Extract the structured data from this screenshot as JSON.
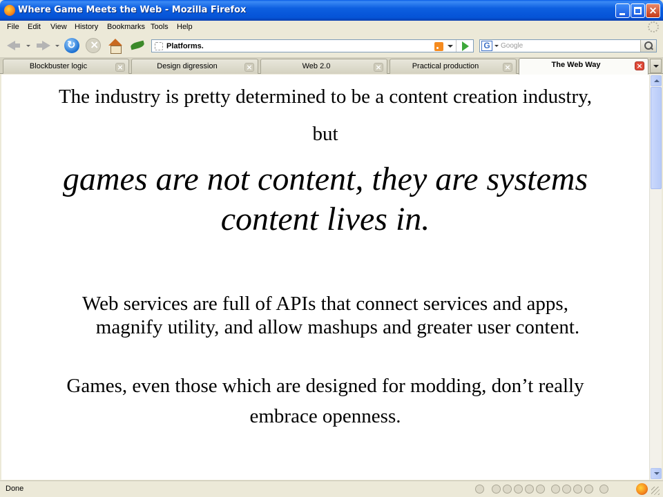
{
  "window": {
    "title": "Where Game Meets the Web - Mozilla Firefox"
  },
  "menu": [
    "File",
    "Edit",
    "View",
    "History",
    "Bookmarks",
    "Tools",
    "Help"
  ],
  "navbar": {
    "url": "Platforms.",
    "search_placeholder": "Google",
    "search_engine_icon": "G"
  },
  "tabs": [
    {
      "label": "Blockbuster logic",
      "active": false
    },
    {
      "label": "Design digression",
      "active": false
    },
    {
      "label": "Web 2.0",
      "active": false
    },
    {
      "label": "Practical production",
      "active": false
    },
    {
      "label": "The Web Way",
      "active": true
    }
  ],
  "slide": {
    "intro_line1": "The industry is pretty determined to be a content creation industry,",
    "intro_line2": "but",
    "quote_line1": "games are not content, they are systems",
    "quote_line2": "content lives in.",
    "web_line1": "Web services are full of APIs that connect services and apps,",
    "web_line2": "magnify utility, and allow mashups and greater user content.",
    "games_line1": "Games, even those which are designed for modding, don’t really",
    "games_line2": "embrace openness."
  },
  "status": {
    "text": "Done"
  },
  "icons": {
    "app": "firefox-icon",
    "back": "back-arrow-icon",
    "forward": "forward-arrow-icon",
    "reload": "reload-icon",
    "stop": "stop-icon",
    "home": "home-icon",
    "addon": "leaf-icon",
    "feed": "rss-icon",
    "go": "go-arrow-icon",
    "search": "magnifier-icon"
  },
  "colors": {
    "titlebar": "#0553d6",
    "chrome": "#ece9d8",
    "active_tab_close": "#e04b3a",
    "page_background": "#ffffff"
  }
}
